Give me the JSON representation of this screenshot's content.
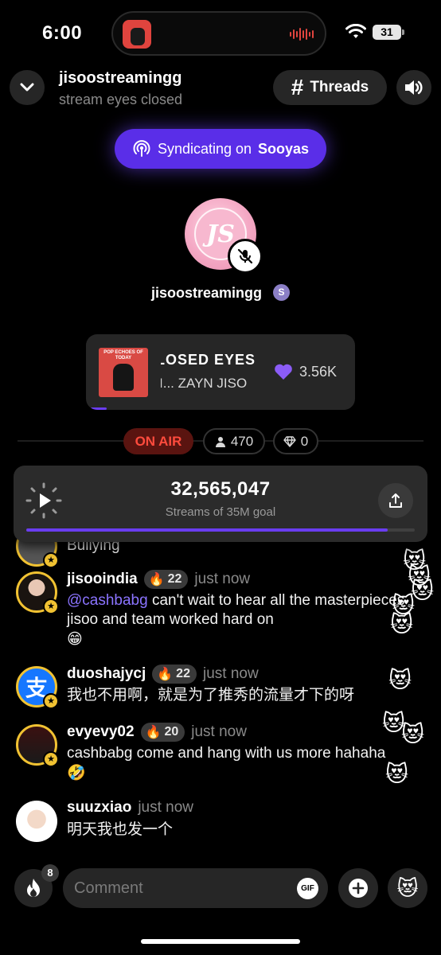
{
  "status_bar": {
    "time": "6:00",
    "battery": "31"
  },
  "header": {
    "title": "jisoostreamingg",
    "subtitle": "stream eyes closed",
    "threads_label": "Threads"
  },
  "syndicate": {
    "prefix": "Syndicating on",
    "platform": "Sooyas"
  },
  "host": {
    "name": "jisoostreamingg",
    "avatar_text": "JS"
  },
  "now_playing": {
    "song": "LOSED    EYES",
    "artist": "I...   ZAYN     JISO",
    "likes": "3.56K",
    "art_title": "POP ECHOES OF TODAY",
    "progress": 0.06
  },
  "live": {
    "status": "ON AIR",
    "viewers": "470",
    "gems": "0"
  },
  "stream": {
    "count": "32,565,047",
    "goal_text": "Streams of 35M goal",
    "progress": 0.93
  },
  "chat": {
    "partial": {
      "text": "Bullying"
    },
    "messages": [
      {
        "user": "jisooindia",
        "level": "22",
        "time": "just now",
        "mention": "@cashbabg",
        "text": " can't wait to hear all the masterpieces jisoo  and team worked hard on",
        "emoji": "😁"
      },
      {
        "user": "duoshajycj",
        "level": "22",
        "time": "just now",
        "text": "我也不用啊，就是为了推秀的流量才下的呀"
      },
      {
        "user": "evyevy02",
        "level": "20",
        "time": "just now",
        "text": "cashbabg come and hang with us more hahaha",
        "emoji": "🤣"
      },
      {
        "user": "suuzxiao",
        "time": "just now",
        "text": "明天我也发一个"
      }
    ]
  },
  "composer": {
    "placeholder": "Comment",
    "gif_label": "GIF",
    "fire_count": "8",
    "emoji": "😻"
  },
  "colors": {
    "accent": "#6a3df0",
    "on_air": "#ff4b3d",
    "gold": "#f1c232"
  }
}
